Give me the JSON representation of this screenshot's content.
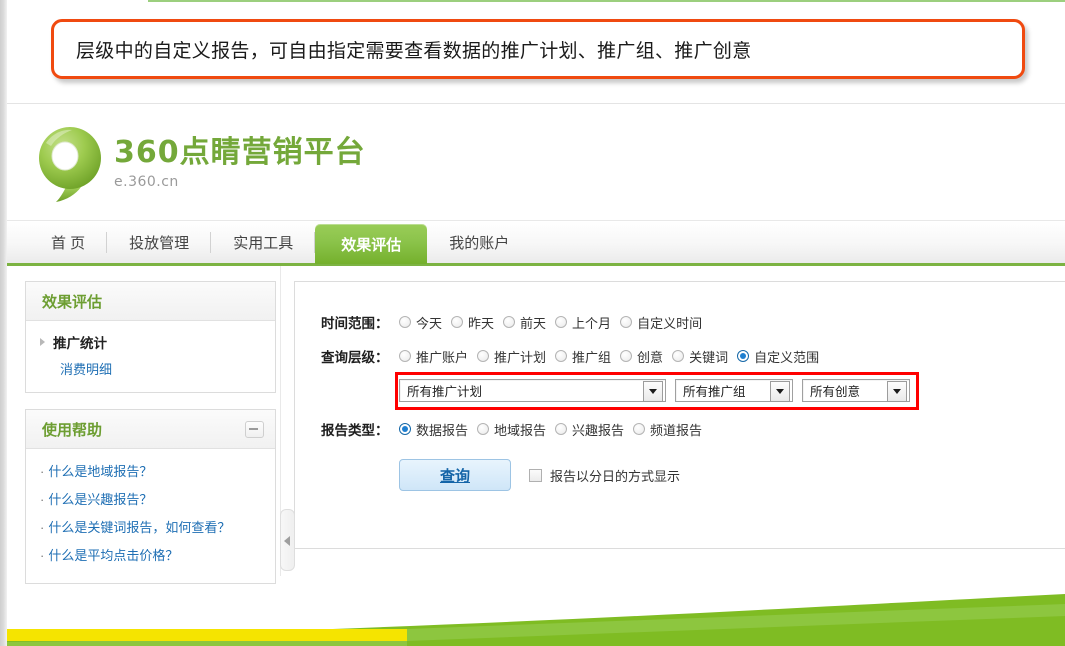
{
  "callout": {
    "text": "层级中的自定义报告，可自由指定需要查看数据的推广计划、推广组、推广创意",
    "border_color": "#f04a10"
  },
  "brand": {
    "logo_title": "360点睛营销平台",
    "logo_sub": "e.360.cn",
    "logo_icon": "speech-bubble-logo-icon",
    "green": "#74a83a"
  },
  "nav": {
    "items": [
      {
        "label": "首 页",
        "active": false
      },
      {
        "label": "投放管理",
        "active": false
      },
      {
        "label": "实用工具",
        "active": false
      },
      {
        "label": "效果评估",
        "active": true
      },
      {
        "label": "我的账户",
        "active": false
      }
    ],
    "active_color": "#8bc34a",
    "underline_color": "#7cb342"
  },
  "sidebar": {
    "nav_panel": {
      "title": "效果评估",
      "parent_item": "推广统计",
      "child_items": [
        "消费明细"
      ]
    },
    "help_panel": {
      "title": "使用帮助",
      "collapse_icon": "minimize-icon",
      "items": [
        "什么是地域报告？",
        "什么是兴趣报告？",
        "什么是关键词报告，如何查看？",
        "什么是平均点击价格？"
      ]
    },
    "splitter_icon": "collapse-left-arrow-icon"
  },
  "form": {
    "time_range": {
      "label": "时间范围：",
      "options": [
        {
          "label": "今天",
          "checked": false
        },
        {
          "label": "昨天",
          "checked": false
        },
        {
          "label": "前天",
          "checked": false
        },
        {
          "label": "上个月",
          "checked": false
        },
        {
          "label": "自定义时间",
          "checked": false
        }
      ]
    },
    "query_level": {
      "label": "查询层级：",
      "options": [
        {
          "label": "推广账户",
          "checked": false
        },
        {
          "label": "推广计划",
          "checked": false
        },
        {
          "label": "推广组",
          "checked": false
        },
        {
          "label": "创意",
          "checked": false
        },
        {
          "label": "关键词",
          "checked": false
        },
        {
          "label": "自定义范围",
          "checked": true
        }
      ]
    },
    "selects": {
      "highlight_color": "#ff0000",
      "plan": {
        "value": "所有推广计划",
        "icon": "chevron-down-icon"
      },
      "group": {
        "value": "所有推广组",
        "icon": "chevron-down-icon"
      },
      "creative": {
        "value": "所有创意",
        "icon": "chevron-down-icon"
      }
    },
    "report_type": {
      "label": "报告类型：",
      "options": [
        {
          "label": "数据报告",
          "checked": true
        },
        {
          "label": "地域报告",
          "checked": false
        },
        {
          "label": "兴趣报告",
          "checked": false
        },
        {
          "label": "频道报告",
          "checked": false
        }
      ]
    },
    "submit": {
      "label": "查询"
    },
    "daily_split": {
      "label": "报告以分日的方式显示",
      "checked": false
    }
  },
  "footer": {
    "green": "#7fbc23",
    "green_dark": "#6fa81e",
    "yellow": "#f5e400"
  }
}
